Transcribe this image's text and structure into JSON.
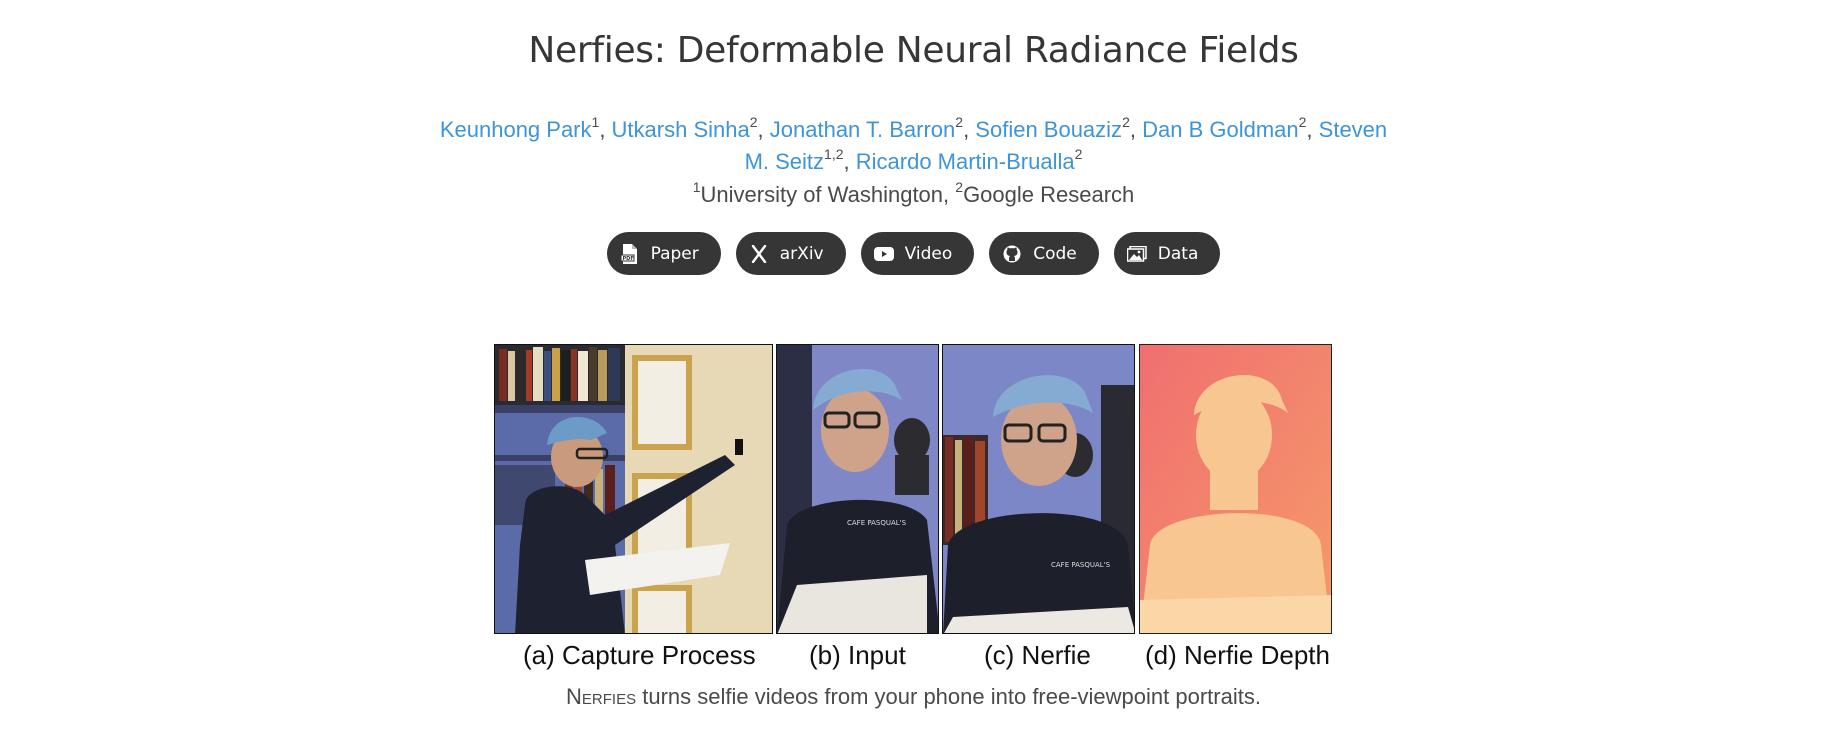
{
  "title": "Nerfies: Deformable Neural Radiance Fields",
  "authors": [
    {
      "name": "Keunhong Park",
      "sup": "1"
    },
    {
      "name": "Utkarsh Sinha",
      "sup": "2"
    },
    {
      "name": "Jonathan T. Barron",
      "sup": "2"
    },
    {
      "name": "Sofien Bouaziz",
      "sup": "2"
    },
    {
      "name": "Dan B Goldman",
      "sup": "2"
    },
    {
      "name": "Steven M. Seitz",
      "sup": "1,2"
    },
    {
      "name": "Ricardo Martin-Brualla",
      "sup": "2"
    }
  ],
  "affiliations": [
    {
      "sup": "1",
      "name": "University of Washington"
    },
    {
      "sup": "2",
      "name": "Google Research"
    }
  ],
  "buttons": [
    {
      "label": "Paper",
      "icon": "pdf-icon"
    },
    {
      "label": "arXiv",
      "icon": "arxiv-icon"
    },
    {
      "label": "Video",
      "icon": "youtube-icon"
    },
    {
      "label": "Code",
      "icon": "github-icon"
    },
    {
      "label": "Data",
      "icon": "images-icon"
    }
  ],
  "figure": {
    "captions": [
      "(a) Capture Process",
      "(b) Input",
      "(c) Nerfie",
      "(d) Nerfie Depth"
    ]
  },
  "tagline": {
    "name": "Nerfies",
    "rest": " turns selfie videos from your phone into free-viewpoint portraits."
  },
  "colors": {
    "link": "#3e94d8",
    "button_bg": "#363636",
    "text": "#4a4a4a"
  }
}
